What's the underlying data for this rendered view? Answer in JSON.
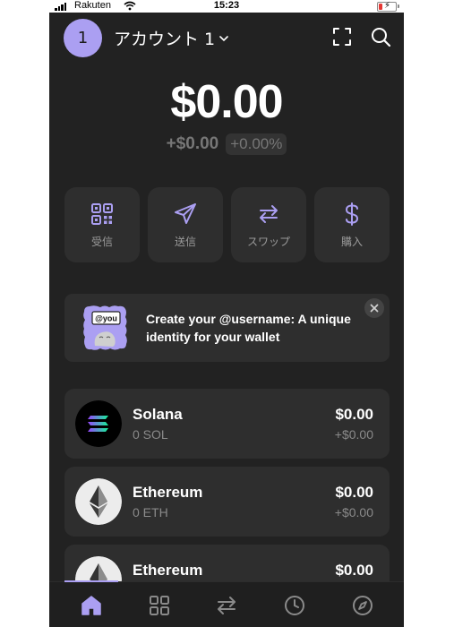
{
  "status_bar": {
    "carrier": "Rakuten",
    "time": "15:23"
  },
  "header": {
    "avatar_initial": "1",
    "account_name": "アカウント 1",
    "icons": [
      "chevron-down-icon",
      "scan-icon",
      "search-icon"
    ]
  },
  "balance": {
    "total": "$0.00",
    "change_amount": "+$0.00",
    "change_percent": "+0.00%"
  },
  "actions": [
    {
      "label": "受信",
      "icon": "qr-code-icon"
    },
    {
      "label": "送信",
      "icon": "send-icon"
    },
    {
      "label": "スワップ",
      "icon": "swap-icon"
    },
    {
      "label": "購入",
      "icon": "dollar-icon"
    }
  ],
  "banner": {
    "tag": "@you",
    "text": "Create your @username: A unique identity for your wallet"
  },
  "tokens": [
    {
      "name": "Solana",
      "balance": "0 SOL",
      "value": "$0.00",
      "change": "+$0.00"
    },
    {
      "name": "Ethereum",
      "balance": "0 ETH",
      "value": "$0.00",
      "change": "+$0.00"
    },
    {
      "name": "Ethereum",
      "balance": "",
      "value": "$0.00",
      "change": ""
    }
  ],
  "bottom_nav": [
    {
      "icon": "home-icon",
      "active": true
    },
    {
      "icon": "grid-icon",
      "active": false
    },
    {
      "icon": "swap-icon",
      "active": false
    },
    {
      "icon": "clock-icon",
      "active": false
    },
    {
      "icon": "compass-icon",
      "active": false
    }
  ],
  "colors": {
    "accent": "#ab9ff2",
    "background": "#222222",
    "card": "#2e2e2e"
  }
}
